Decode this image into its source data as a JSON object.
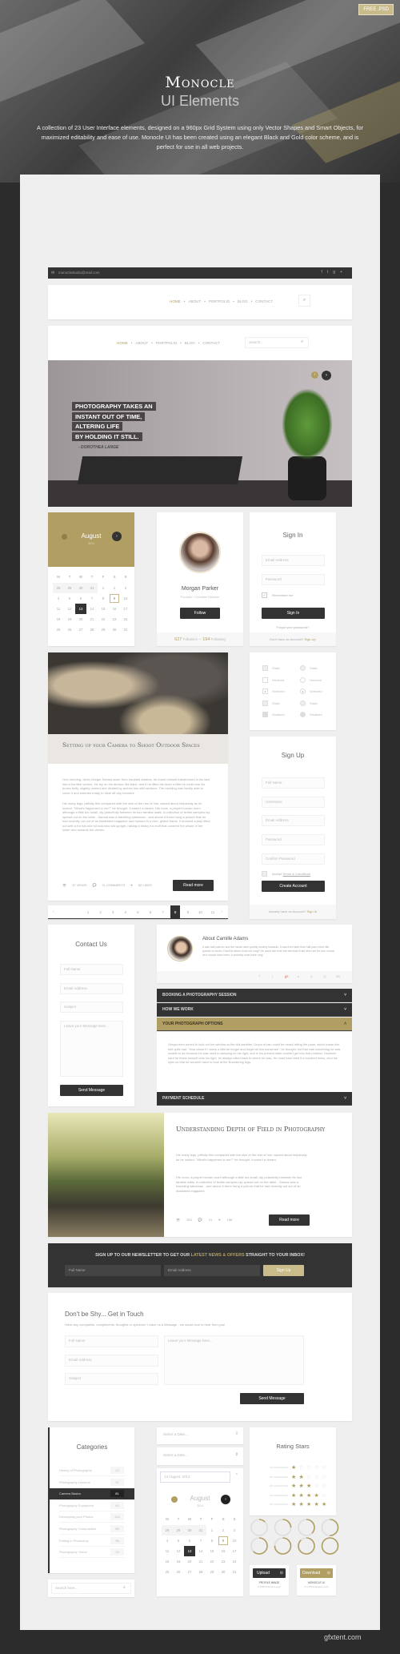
{
  "hero": {
    "badge": "FREE .PSD",
    "title": "Monocle",
    "subtitle": "UI Elements",
    "description": "A collection of 23 User Interface elements, designed on a 960px Grid System using only Vector Shapes and Smart Objects,  for maximized editability and ease of use.  Monocle UI has been created using an elegant Black and Gold color scheme, and is perfect for use in all web projects."
  },
  "colors": {
    "gold": "#b09e63",
    "dark": "#333333",
    "background": "#efefef"
  },
  "topbar": {
    "email": "monoclestudio@mail.com",
    "social": [
      "f",
      "t",
      "g+"
    ]
  },
  "nav": {
    "items": [
      "HOME",
      "ABOUT",
      "PORTFOLIO",
      "BLOG",
      "CONTACT"
    ],
    "separator": "•",
    "search_placeholder": "Search..."
  },
  "slider": {
    "quote": [
      "PHOTOGRAPHY TAKES AN",
      "INSTANT OUT OF TIME,",
      "ALTERING LIFE",
      "BY HOLDING IT STILL."
    ],
    "author": "- DOROTHEA LANGE"
  },
  "calendar": {
    "month": "August",
    "year": "2014",
    "weekdays": [
      "M",
      "T",
      "W",
      "T",
      "F",
      "S",
      "S"
    ],
    "days": [
      [
        "28",
        "29",
        "30",
        "31",
        "1",
        "2",
        "3"
      ],
      [
        "4",
        "5",
        "6",
        "7",
        "8",
        "9",
        "10"
      ],
      [
        "11",
        "12",
        "13",
        "14",
        "15",
        "16",
        "17"
      ],
      [
        "18",
        "19",
        "20",
        "21",
        "22",
        "23",
        "24"
      ],
      [
        "25",
        "26",
        "27",
        "28",
        "29",
        "30",
        "31"
      ]
    ],
    "selected": "13",
    "highlighted": "9"
  },
  "profile": {
    "name": "Morgan Parker",
    "role": "Founder / Creative Director",
    "follow": "Follow",
    "followers": "627",
    "followers_label": "Followers",
    "following": "194",
    "following_label": "Following"
  },
  "signin": {
    "title": "Sign In",
    "email": "Email Address",
    "password": "Password",
    "remember": "Remember me",
    "button": "Sign In",
    "forgot": "Forgot your password?",
    "no_account": "Don't have an Account?",
    "signup": "Sign Up"
  },
  "blog": {
    "title": "Setting up your Camera to Shoot Outdoor Spaces",
    "p1": "One morning, when Gregor Samsa woke from troubled dreams, he found himself transformed in his bed into a horrible vermin. He lay on his armour-like back, and if he lifted his head a little he could see his brown belly, slightly domed and divided by arches into stiff sections. The bedding was hardly able to cover it and seemed ready to slide off any moment.",
    "p2": "His many legs, pitifully thin compared with the size of the rest of him, waved about helplessly as he looked. \"What's happened to me?\" he thought. It wasn't a dream. His room, a proper human room although a little too small, lay peacefully between its four familiar walls. A collection of textile samples lay spread out on the table - Samsa was a travelling salesman - and above it there hung a picture that he had recently cut out of an illustrated magazine and housed in a nice, gilded frame. It showed a lady fitted out with a fur hat and fur boa who sat upright, raising a heavy fur muff that covered the whole of her lower arm towards the viewer.",
    "views": "37 VIEWS",
    "comments": "21 COMMENTS",
    "likes": "52 LIKES",
    "read_more": "Read more"
  },
  "pagination": {
    "prev": "‹",
    "next": "›",
    "pages": [
      "1",
      "2",
      "3",
      "4",
      "5",
      "6",
      "7",
      "8",
      "9",
      "10",
      "11"
    ],
    "current": "8"
  },
  "controls": {
    "checkboxes": [
      "Static",
      "Hovered",
      "Selected",
      "Static",
      "Disabled"
    ],
    "radios": [
      "Static",
      "Hovered",
      "Selected",
      "Static",
      "Disabled"
    ]
  },
  "signup": {
    "title": "Sign Up",
    "fields": [
      "Full Name",
      "Username",
      "Email Address",
      "Password",
      "Confirm Password"
    ],
    "accept": "Accept",
    "terms": "Terms & Conditions",
    "button": "Create Account",
    "have_account": "Already have an Account?",
    "signin": "Sign In"
  },
  "contact": {
    "title": "Contact Us",
    "fields": [
      "Full Name",
      "Email Address",
      "Subject"
    ],
    "message": "Leave your Message here...",
    "button": "Send Message"
  },
  "about": {
    "title": "About Camille Adams",
    "text": "It was half past six and the hands were quietly moving forwards, it was even later than half past, more like quarter to seven. Had the alarm clock not rung? He could see from the bed that it had been set for four o'clock as it should have been; it certainly must have rung.",
    "social": [
      "f",
      "t",
      "g+",
      "▸",
      "p",
      "◎",
      "Be"
    ]
  },
  "accordion": {
    "items": [
      "BOOKING A PHOTOGRAPHY SESSION",
      "HOW WE WORK",
      "YOUR PHOTOGRAPH OPTIONS",
      "PAYMENT SCHEDULE"
    ],
    "open_index": 2,
    "open_text": "Gregor then turned to look out the window at the dull weather. Drops of rain could be heard hitting the pane, which made him feel quite sad. \"How about if I sleep a little bit longer and forget all this nonsense\", he thought, but that was something he was unable to do because he was used to sleeping on his right, and in his present state couldn't get into that position. However hard he threw himself onto his right, he always rolled back to where he was. He must have tried it a hundred times, shut his eyes so that he wouldn't have to look at the floundering legs."
  },
  "blog2": {
    "title": "Understanding Depth of Field in Photography",
    "p1": "His many legs, pitifully thin compared with the size of the rest of him, waved about helplessly as he looked. \"What's happened to me?\" he thought. It wasn't a dream.",
    "p2": "His room, a proper human room although a little too small, lay peacefully between its four familiar walls. A collection of textile samples lay spread out on the table - Samsa was a travelling salesman - and above it there hung a picture that he had recently cut out of an illustrated magazine.",
    "views": "253",
    "comments": "41",
    "likes": "158",
    "read_more": "Read more"
  },
  "newsletter": {
    "text_before": "SIGN UP TO OUR NEWSLETTER TO GET OUR ",
    "highlight": "LATEST NEWS & OFFERS",
    "text_after": " STRAIGHT TO YOUR INBOX!",
    "name": "Full Name",
    "email": "Email Address",
    "button": "Sign Up"
  },
  "touch": {
    "title": "Don't be Shy... Get in Touch",
    "subtitle": "Have any complaints, compliments, thoughts or opinions? Leave us a Message - we would love to hear from you!",
    "fields": [
      "Full Name",
      "Email Address",
      "Subject"
    ],
    "message": "Leave your Message here...",
    "button": "Send Message"
  },
  "categories": {
    "title": "Categories",
    "items": [
      {
        "label": "History of Photography",
        "count": "23"
      },
      {
        "label": "Photography Lessons",
        "count": "37"
      },
      {
        "label": "Camera Basics",
        "count": "81"
      },
      {
        "label": "Photography Equipment",
        "count": "40"
      },
      {
        "label": "Developing your Photos",
        "count": "115"
      },
      {
        "label": "Photography Composition",
        "count": "58"
      },
      {
        "label": "Editing in Photoshop",
        "count": "96"
      },
      {
        "label": "Photography Terms",
        "count": "19"
      }
    ],
    "active_index": 2,
    "search": "Search here..."
  },
  "datepicker": {
    "select1": "Select a Date...",
    "select2": "Select a Date...",
    "value": "13 August, 2014"
  },
  "rating": {
    "title": "Rating Stars",
    "rows": [
      {
        "label": "1/5 STAR RATING",
        "stars": 1
      },
      {
        "label": "2/5 STAR RATING",
        "stars": 2
      },
      {
        "label": "3/5 STAR RATING",
        "stars": 3
      },
      {
        "label": "4/5 STAR RATING",
        "stars": 4
      },
      {
        "label": "5/5 STAR RATING",
        "stars": 5
      }
    ]
  },
  "progress_rings": [
    0.125,
    0.25,
    0.375,
    0.5,
    0.625,
    0.75,
    0.875,
    1.0
  ],
  "uploads": {
    "upload": "Upload",
    "upload_name": "PROFILE IMAGE",
    "upload_meta": "2.5KB (Filename.jpg)",
    "download": "Download",
    "download_name": "MONOCLE UI",
    "download_meta": "5.4 KB (Filename.psd)"
  },
  "watermark": "gfxtent.com"
}
